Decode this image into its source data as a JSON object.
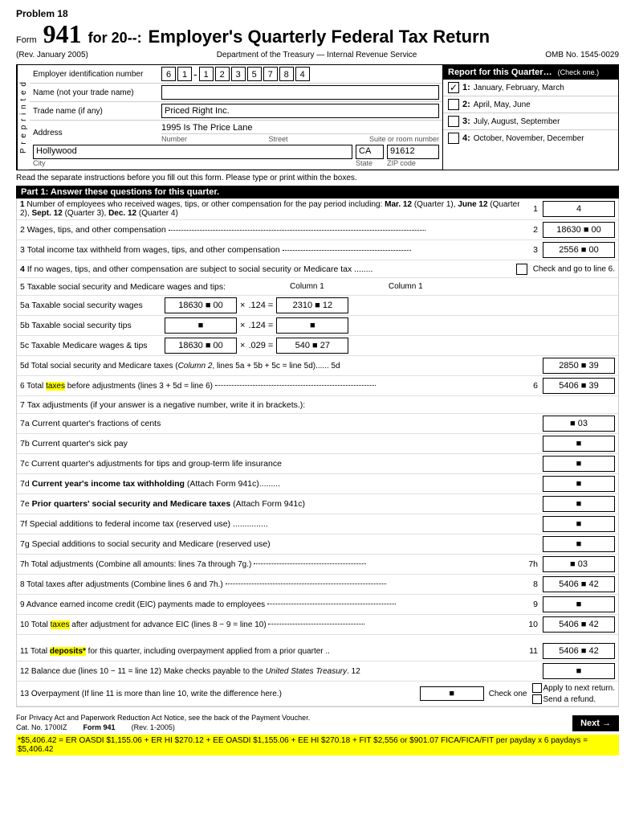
{
  "problem": "Problem 18",
  "form": {
    "number": "941",
    "for_year": "for 20--:",
    "title": "Employer's Quarterly Federal Tax Return",
    "rev": "(Rev. January 2005)",
    "dept": "Department of the Treasury — Internal Revenue Service",
    "omb": "OMB No. 1545-0029"
  },
  "employer": {
    "ein_label": "Employer identification number",
    "ein_digits": [
      "6",
      "1",
      "-",
      "1",
      "2",
      "3",
      "5",
      "7",
      "8",
      "4"
    ],
    "name_label": "Name (not your trade name)",
    "name_value": "",
    "trade_label": "Trade name (if any)",
    "trade_value": "Priced Right Inc.",
    "address_label": "Address",
    "address_line1": "1995 Is The Price Lane",
    "number_label": "Number",
    "street_label": "Street",
    "suite_label": "Suite or room number",
    "city_value": "Hollywood",
    "state_value": "CA",
    "zip_value": "91612",
    "city_label": "City",
    "state_label": "State",
    "zip_label": "ZIP code"
  },
  "preprinted_label": "P r e p r i n t e d",
  "report_quarter": {
    "header": "Report for this Quarter…",
    "check_one": "(Check one.)",
    "options": [
      {
        "num": "1:",
        "label": "January, February, March",
        "checked": true
      },
      {
        "num": "2:",
        "label": "April, May, June",
        "checked": false
      },
      {
        "num": "3:",
        "label": "July, August, September",
        "checked": false
      },
      {
        "num": "4:",
        "label": "October, November, December",
        "checked": false
      }
    ]
  },
  "read_note": "Read the separate instructions before you fill out this form. Please type or print within the boxes.",
  "part1_header": "Part 1: Answer these questions for this quarter.",
  "lines": {
    "line1": {
      "text": "1 Number of employees who received wages, tips, or other compensation for the pay period including: Mar. 12 (Quarter 1), June 12 (Quarter 2), Sept. 12 (Quarter 3), Dec. 12 (Quarter 4)",
      "num": "1",
      "value": "4"
    },
    "line2": {
      "text": "2 Wages, tips, and other compensation",
      "num": "2",
      "value": "18630 ■ 00"
    },
    "line3": {
      "text": "3 Total income tax withheld from wages, tips, and other compensation",
      "num": "3",
      "value": "2556 ■ 00"
    },
    "line4": {
      "text": "4 If no wages, tips, and other compensation are subject to social security or Medicare tax ........",
      "check_go": "Check and go to line 6."
    },
    "line5_header": "5 Taxable social security and Medicare wages and tips:",
    "col1_header": "Column 1",
    "col2_header": "Column 1",
    "line5a": {
      "label": "5a Taxable social security wages",
      "col1": "18630 ■ 00",
      "rate": "× .124 =",
      "col2": "2310 ■ 12"
    },
    "line5b": {
      "label": "5b Taxable social security tips",
      "col1": "■",
      "rate": "× .124 =",
      "col2": "■"
    },
    "line5c": {
      "label": "5c Taxable Medicare wages & tips",
      "col1": "18630 ■ 00",
      "rate": "× .029 =",
      "col2": "540 ■ 27"
    },
    "line5d": {
      "text": "5d Total social security and Medicare taxes (Column 2, lines 5a + 5b + 5c = line 5d)...... 5d",
      "num": "5d",
      "value": "2850 ■ 39"
    },
    "line6": {
      "text": "6 Total taxes before adjustments (lines 3 + 5d = line 6)",
      "num": "6",
      "value": "5406 ■ 39",
      "bold_word": "taxes"
    },
    "line7_header": "7 Tax adjustments (if your answer is a negative number, write it in brackets.):",
    "line7a": {
      "label": "7a Current quarter's fractions of cents",
      "value": "■ 03"
    },
    "line7b": {
      "label": "7b Current quarter's sick pay",
      "value": "■"
    },
    "line7c": {
      "label": "7c Current quarter's adjustments for tips and group-term life insurance",
      "value": "■"
    },
    "line7d": {
      "label": "7d Current year's income tax withholding (Attach Form 941c).........",
      "value": "■"
    },
    "line7e": {
      "label": "7e Prior quarters' social security and Medicare taxes (Attach Form 941c)",
      "value": "■"
    },
    "line7f": {
      "label": "7f Special additions to federal income tax (reserved use) ...............",
      "value": "■"
    },
    "line7g": {
      "label": "7g Special additions to social security and Medicare (reserved use)",
      "value": "■"
    },
    "line7h": {
      "text": "7h Total adjustments (Combine all amounts: lines 7a through 7g.)",
      "num": "7h",
      "value": "■ 03"
    },
    "line8": {
      "text": "8 Total taxes after adjustments (Combine lines 6 and 7h.)",
      "num": "8",
      "value": "5406 ■ 42"
    },
    "line9": {
      "text": "9 Advance earned income credit (EIC) payments made to employees",
      "num": "9",
      "value": "■"
    },
    "line10": {
      "text": "10 Total taxes after adjustment for advance EIC (lines 8 − 9 = line 10)",
      "num": "10",
      "value": "5406 ■ 42",
      "bold_word": "taxes"
    },
    "line11": {
      "text": "11 Total deposits* for this quarter, including overpayment applied from a prior quarter ..",
      "num": "11",
      "value": "5406 ■ 42",
      "bold_word": "deposits*"
    },
    "line12": {
      "text": "12 Balance due (lines 10 − 11 = line 12) Make checks payable to the United States Treasury.",
      "num": "12",
      "value": "■"
    },
    "line13": {
      "text": "13 Overpayment (If line 11 is more than line 10, write the difference here.)",
      "value": "■",
      "check_one": "Check one",
      "apply_label": "Apply to next return.",
      "send_label": "Send a refund."
    }
  },
  "footer": {
    "privacy_note": "For Privacy Act and Paperwork Reduction Act Notice, see the back of the Payment Voucher.",
    "cat": "Cat. No. 1700IZ",
    "form": "Form 941",
    "rev": "(Rev. 1-2005)",
    "next_label": "Next →"
  },
  "bottom_note": "*$5,406.42 = ER OASDI $1,155.06 + ER HI $270.12 + EE OASDI $1,155.06 + EE HI $270.18 + FIT $2,556 or $901.07 FICA/FICA/FIT per payday x 6 paydays = $5,406.42"
}
